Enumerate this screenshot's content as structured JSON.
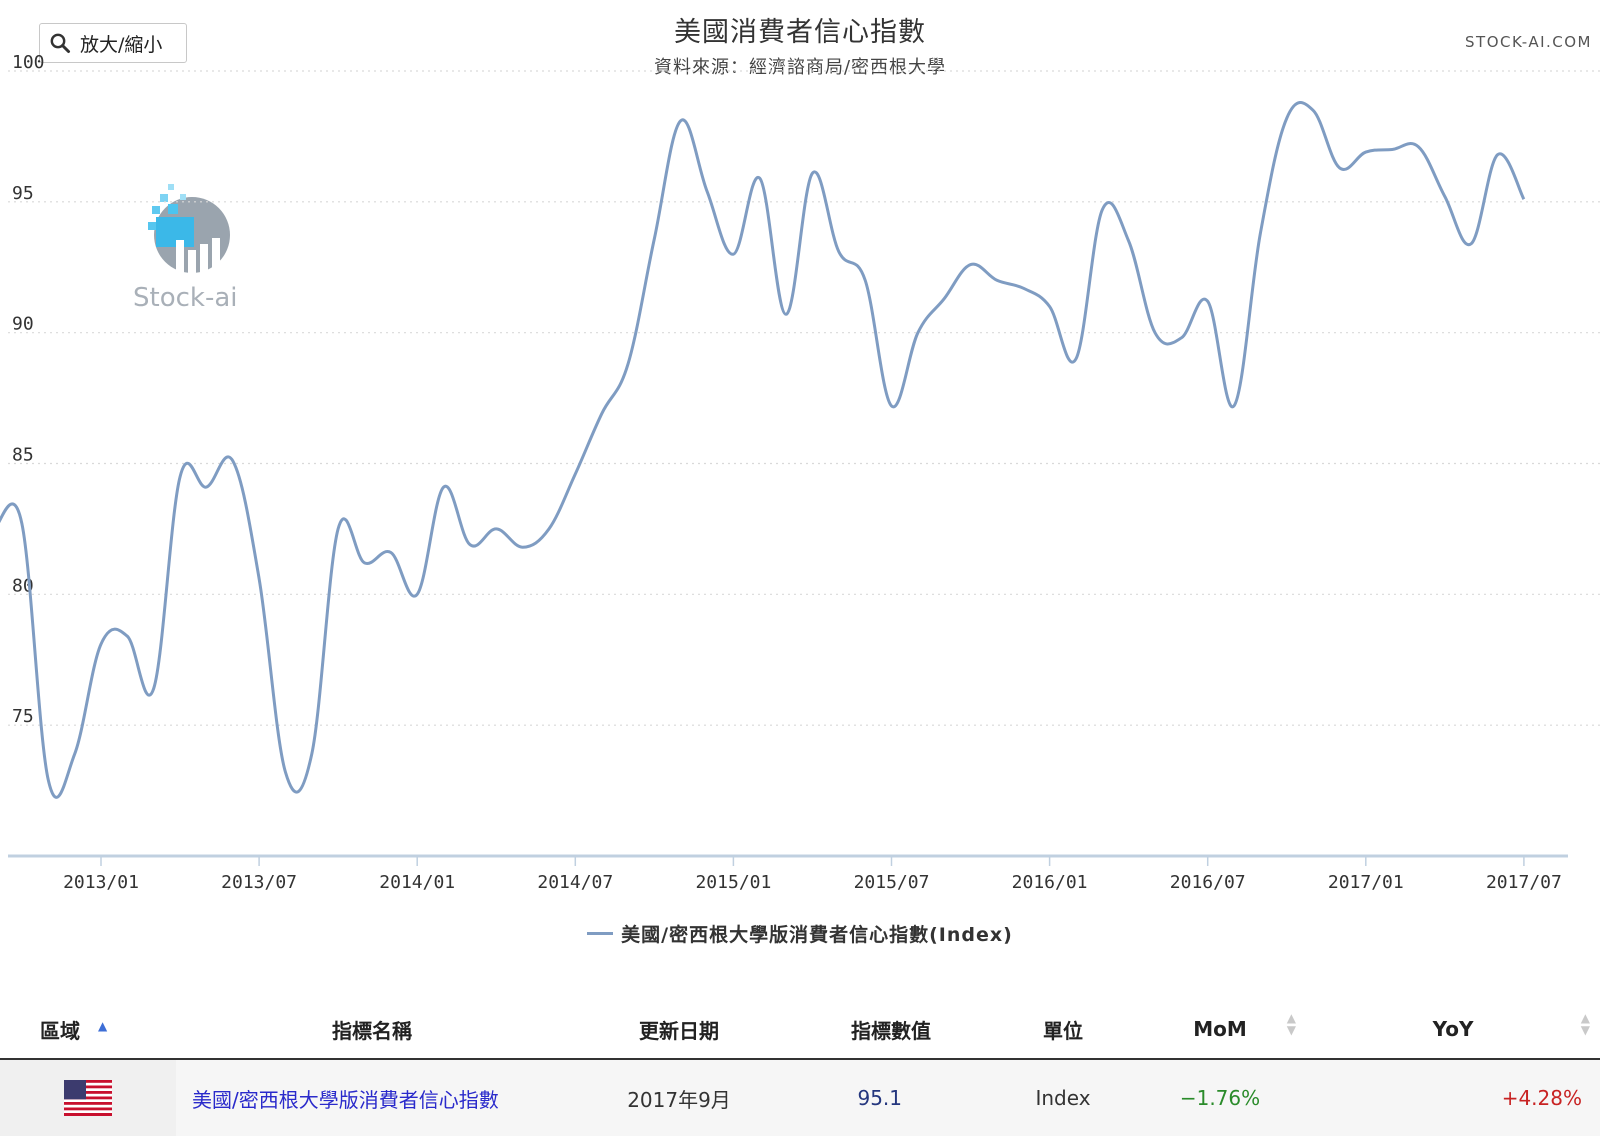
{
  "toolbar": {
    "zoom_label": "放大/縮小"
  },
  "brand": "STOCK-AI.COM",
  "logo": {
    "text": "Stock-ai"
  },
  "colors": {
    "series": "#7f9cc2",
    "grid": "#d9d9d9",
    "axis": "#c0d0e0",
    "mom": "#2a8b2a",
    "yoy": "#c82222",
    "link": "#2a2acb"
  },
  "chart_data": {
    "type": "line",
    "title": "美國消費者信心指數",
    "subtitle": "資料來源：經濟諮商局/密西根大學",
    "xlabel": "",
    "ylabel": "",
    "ylim": [
      70,
      100
    ],
    "y_ticks": [
      75,
      80,
      85,
      90,
      95,
      100
    ],
    "x_ticks": [
      "2013/01",
      "2013/07",
      "2014/01",
      "2014/07",
      "2015/01",
      "2015/07",
      "2016/01",
      "2016/07",
      "2017/01",
      "2017/07"
    ],
    "grid": true,
    "legend_position": "bottom-center",
    "x": [
      "2012/09",
      "2012/10",
      "2012/11",
      "2012/12",
      "2013/01",
      "2013/02",
      "2013/03",
      "2013/04",
      "2013/05",
      "2013/06",
      "2013/07",
      "2013/08",
      "2013/09",
      "2013/10",
      "2013/11",
      "2013/12",
      "2014/01",
      "2014/02",
      "2014/03",
      "2014/04",
      "2014/05",
      "2014/06",
      "2014/07",
      "2014/08",
      "2014/09",
      "2014/10",
      "2014/11",
      "2014/12",
      "2015/01",
      "2015/02",
      "2015/03",
      "2015/04",
      "2015/05",
      "2015/06",
      "2015/07",
      "2015/08",
      "2015/09",
      "2015/10",
      "2015/11",
      "2015/12",
      "2016/01",
      "2016/02",
      "2016/03",
      "2016/04",
      "2016/05",
      "2016/06",
      "2016/07",
      "2016/08",
      "2016/09",
      "2016/10",
      "2016/11",
      "2016/12",
      "2017/01",
      "2017/02",
      "2017/03",
      "2017/04",
      "2017/05",
      "2017/06",
      "2017/07",
      "2017/08",
      "2017/09"
    ],
    "series": [
      {
        "name": "美國/密西根大學版消費者信心指數(Index)",
        "values": [
          82.6,
          82.7,
          72.9,
          73.9,
          78.1,
          78.4,
          76.4,
          84.5,
          84.1,
          85.1,
          80.6,
          73.2,
          73.9,
          82.5,
          81.2,
          81.6,
          80.0,
          84.1,
          81.9,
          82.5,
          81.8,
          82.5,
          84.6,
          86.9,
          88.8,
          93.6,
          98.1,
          95.4,
          93.0,
          95.9,
          90.7,
          96.1,
          93.1,
          92.0,
          87.2,
          90.0,
          91.3,
          92.6,
          92.0,
          91.7,
          91.0,
          89.0,
          94.7,
          93.5,
          90.0,
          89.8,
          91.2,
          87.2,
          93.8,
          98.2,
          98.5,
          96.3,
          96.9,
          97.0,
          97.1,
          95.2,
          93.4,
          96.8,
          95.1
        ]
      }
    ]
  },
  "table": {
    "headers": {
      "region": "區域",
      "name": "指標名稱",
      "date": "更新日期",
      "value": "指標數值",
      "unit": "單位",
      "mom": "MoM",
      "yoy": "YoY"
    },
    "rows": [
      {
        "name": "美國/密西根大學版消費者信心指數",
        "date": "2017年9月",
        "value": "95.1",
        "unit": "Index",
        "mom": "−1.76%",
        "yoy": "+4.28%"
      }
    ]
  }
}
